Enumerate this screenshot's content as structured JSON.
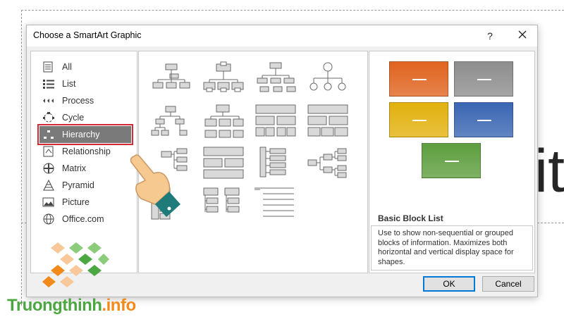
{
  "dialog": {
    "title": "Choose a SmartArt Graphic",
    "help_label": "?",
    "close_icon": "close-icon"
  },
  "categories": [
    {
      "label": "All",
      "icon": "all-icon",
      "selected": false
    },
    {
      "label": "List",
      "icon": "list-icon",
      "selected": false
    },
    {
      "label": "Process",
      "icon": "process-icon",
      "selected": false
    },
    {
      "label": "Cycle",
      "icon": "cycle-icon",
      "selected": false
    },
    {
      "label": "Hierarchy",
      "icon": "hierarchy-icon",
      "selected": true
    },
    {
      "label": "Relationship",
      "icon": "relationship-icon",
      "selected": false
    },
    {
      "label": "Matrix",
      "icon": "matrix-icon",
      "selected": false
    },
    {
      "label": "Pyramid",
      "icon": "pyramid-icon",
      "selected": false
    },
    {
      "label": "Picture",
      "icon": "picture-icon",
      "selected": false
    },
    {
      "label": "Office.com",
      "icon": "globe-icon",
      "selected": false
    }
  ],
  "preview": {
    "colors": [
      "#e0641f",
      "#8e8e8e",
      "#e2b10e",
      "#3a66b3",
      "#5e9e3e"
    ],
    "layout_name": "Basic Block List",
    "description": "Use to show non-sequential or grouped blocks of information. Maximizes both horizontal and vertical display space for shapes."
  },
  "buttons": {
    "ok": "OK",
    "cancel": "Cancel"
  },
  "background": {
    "slide_text": "it"
  },
  "watermark": {
    "brand_part1": "Truongthinh",
    "brand_part2": ".info",
    "colors": [
      "#4ca742",
      "#f28a1b"
    ]
  }
}
